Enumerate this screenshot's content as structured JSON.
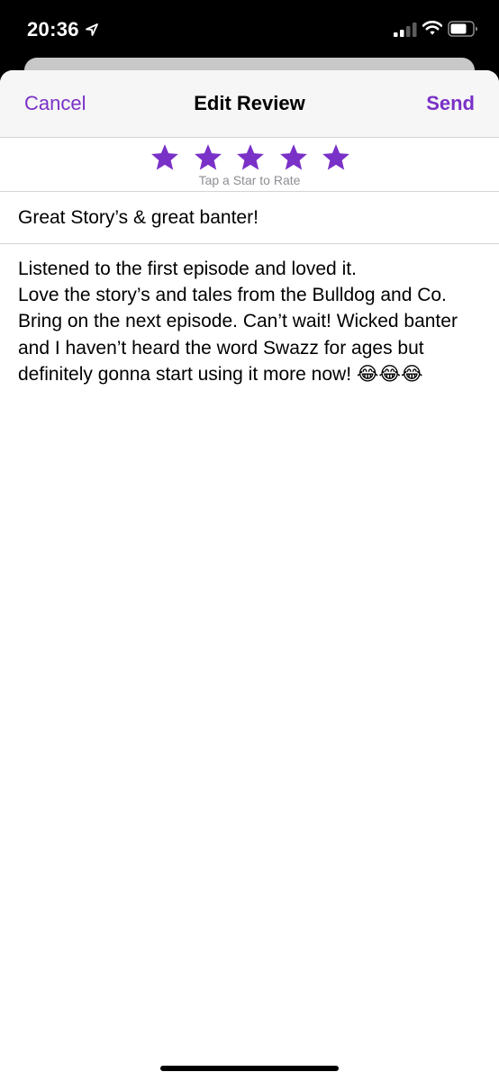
{
  "status_bar": {
    "time": "20:36",
    "icons": [
      "location-arrow-icon",
      "cellular-signal-icon",
      "wifi-icon",
      "battery-icon"
    ]
  },
  "navbar": {
    "cancel_label": "Cancel",
    "title": "Edit Review",
    "send_label": "Send"
  },
  "rating": {
    "value": 5,
    "max": 5,
    "hint": "Tap a Star to Rate"
  },
  "review": {
    "title": "Great Story’s & great banter!",
    "body": "Listened to the first episode and loved it.\nLove the story’s and tales from the Bulldog and Co. Bring on the next episode. Can’t wait! Wicked banter and I haven’t heard the word Swazz for ages but definitely gonna start using it more now! 😂😂😂"
  },
  "colors": {
    "accent": "#7a31c7",
    "nav_background": "#f6f6f6",
    "hint_gray": "#8e8e93",
    "divider": "#d4d4d6"
  }
}
